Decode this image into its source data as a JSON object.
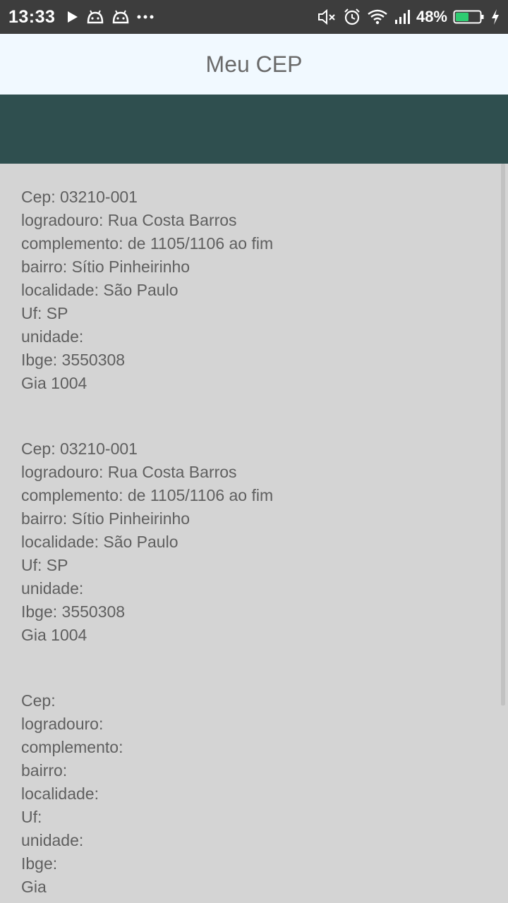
{
  "status_bar": {
    "time": "13:33",
    "battery": "48%",
    "icons_left": [
      "play-icon",
      "android-icon",
      "android-icon",
      "more-dots-icon"
    ],
    "icons_right": [
      "mute-icon",
      "alarm-icon",
      "wifi-icon",
      "signal-icon",
      "battery-icon",
      "charging-icon"
    ]
  },
  "app_bar": {
    "title": "Meu CEP"
  },
  "colors": {
    "status_bar": "#3d3d3d",
    "app_bar": "#f1f9ff",
    "header_band": "#2f4f4f",
    "content_bg": "#d4d4d4",
    "text": "#5f5f5f",
    "battery_fill": "#2ecc71"
  },
  "records": [
    {
      "cep": "Cep: 03210-001",
      "logradouro": "logradouro: Rua Costa Barros",
      "complemento": "complemento: de 1105/1106 ao fim",
      "bairro": "bairro: Sítio Pinheirinho",
      "localidade": "localidade: São Paulo",
      "uf": "Uf: SP",
      "unidade": "unidade:",
      "ibge": "Ibge: 3550308",
      "gia": "Gia 1004"
    },
    {
      "cep": "Cep: 03210-001",
      "logradouro": "logradouro: Rua Costa Barros",
      "complemento": "complemento: de 1105/1106 ao fim",
      "bairro": "bairro: Sítio Pinheirinho",
      "localidade": "localidade: São Paulo",
      "uf": "Uf: SP",
      "unidade": "unidade:",
      "ibge": "Ibge: 3550308",
      "gia": "Gia 1004"
    },
    {
      "cep": "Cep:",
      "logradouro": "logradouro:",
      "complemento": "complemento:",
      "bairro": "bairro:",
      "localidade": "localidade:",
      "uf": "Uf:",
      "unidade": "unidade:",
      "ibge": "Ibge:",
      "gia": "Gia"
    }
  ]
}
